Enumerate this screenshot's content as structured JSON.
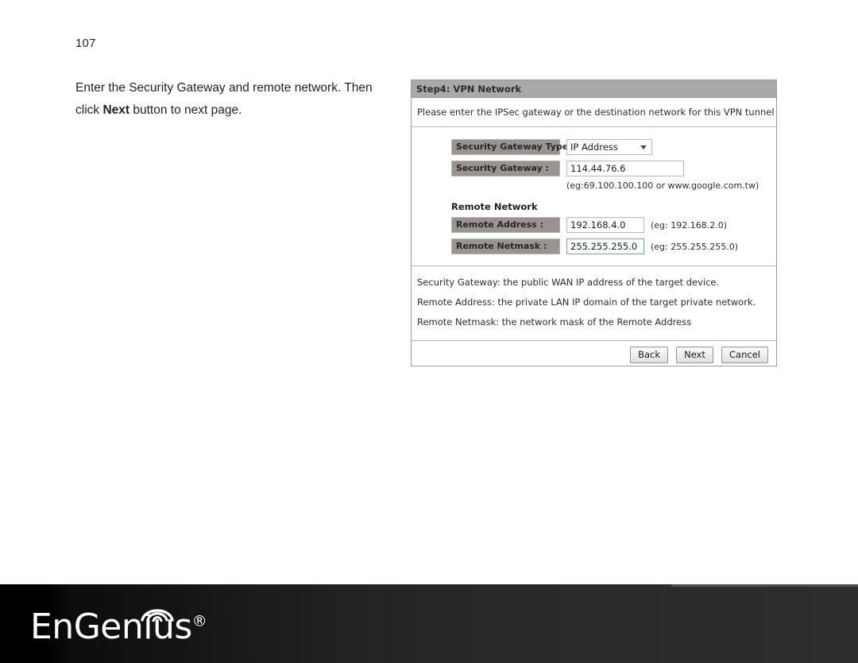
{
  "page": {
    "number": "107",
    "instruction_part1": "Enter the Security Gateway and remote network. Then click ",
    "instruction_bold": "Next",
    "instruction_part2": " button to next page."
  },
  "panel": {
    "title": "Step4: VPN Network",
    "intro": "Please enter the IPSec gateway or the destination network for this VPN tunnel",
    "fields": {
      "gateway_type_label": "Security Gateway Type :",
      "gateway_type_value": "IP Address",
      "gateway_label": "Security Gateway :",
      "gateway_value": "114.44.76.6",
      "gateway_hint": "(eg:69.100.100.100 or www.google.com.tw)",
      "remote_network_heading": "Remote Network",
      "remote_address_label": "Remote Address :",
      "remote_address_value": "192.168.4.0",
      "remote_address_hint": "(eg: 192.168.2.0)",
      "remote_netmask_label": "Remote Netmask :",
      "remote_netmask_value": "255.255.255.0",
      "remote_netmask_hint": "(eg: 255.255.255.0)"
    },
    "notes": [
      "Security Gateway: the public WAN IP address of the target device.",
      "Remote Address: the private LAN IP domain of the target private network.",
      "Remote Netmask: the network mask of the Remote Address"
    ],
    "buttons": {
      "back": "Back",
      "next": "Next",
      "cancel": "Cancel"
    },
    "colors": {
      "titlebar_bg": "#a9a9a9",
      "label_bg": "#9a9491",
      "panel_border": "#9d9d9d",
      "focus_border": "#7d9bb5"
    }
  },
  "footer": {
    "brand_name": "EnGenius",
    "registered_mark": "®",
    "background": "#1c1c1c"
  }
}
